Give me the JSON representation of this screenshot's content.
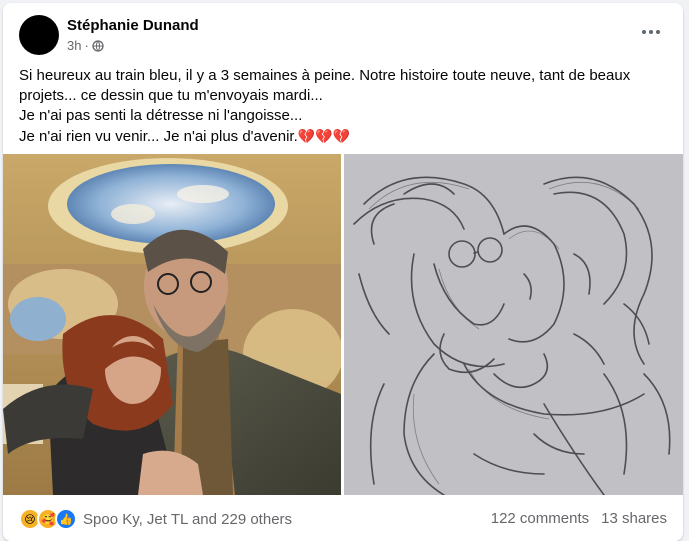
{
  "post": {
    "author": "Stéphanie Dunand",
    "time": "3h",
    "separator": "·",
    "privacy_icon": "globe-icon",
    "more_icon": "more-options-icon",
    "text_lines": [
      "Si heureux au train bleu, il y a 3 semaines à peine. Notre histoire toute neuve, tant de beaux projets... ce dessin que tu m'envoyais mardi...",
      "Je n'ai pas senti la détresse ni l'angoisse...",
      "Je n'ai rien vu venir... Je n'ai plus d'avenir."
    ],
    "emoji_suffix": "💔💔💔"
  },
  "media": {
    "left_photo": "selfie-photo",
    "right_photo": "pencil-sketch-photo"
  },
  "footer": {
    "reaction_icons": [
      "sad-reaction-icon",
      "care-reaction-icon",
      "like-reaction-icon"
    ],
    "reaction_summary": "Spoo Ky, Jet TL and 229 others",
    "comments": "122 comments",
    "shares": "13 shares"
  },
  "colors": {
    "background": "#f0f2f5",
    "card": "#ffffff",
    "secondary_text": "#65676b",
    "like_blue": "#1877f2",
    "heart_red": "#d8314a"
  }
}
